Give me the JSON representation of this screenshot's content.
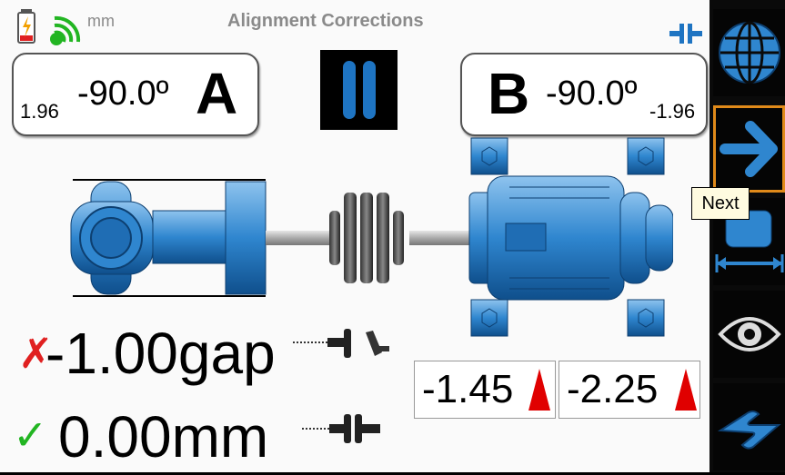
{
  "header": {
    "title": "Alignment Corrections",
    "unit": "mm",
    "icons": [
      "battery-icon",
      "wifi-signal-icon",
      "coupling-icon"
    ]
  },
  "sensor_a": {
    "small_value": "1.96",
    "angle": "-90.0º",
    "label": "A"
  },
  "sensor_b": {
    "small_value": "-1.96",
    "angle": "-90.0º",
    "label": "B"
  },
  "gap": {
    "status": "✗",
    "value": "-1.00gap"
  },
  "offset": {
    "status": "✓",
    "value": "0.00mm"
  },
  "feet": {
    "left_value": "-1.45",
    "right_value": "-2.25"
  },
  "sidebar": {
    "buttons": [
      "globe-button",
      "next-button",
      "dimensions-button",
      "view-button",
      "shim-button"
    ],
    "tooltip": "Next"
  },
  "colors": {
    "accent": "#1e74c2",
    "error": "#e02020",
    "ok": "#22b522",
    "arrow_up": "#e00000"
  }
}
